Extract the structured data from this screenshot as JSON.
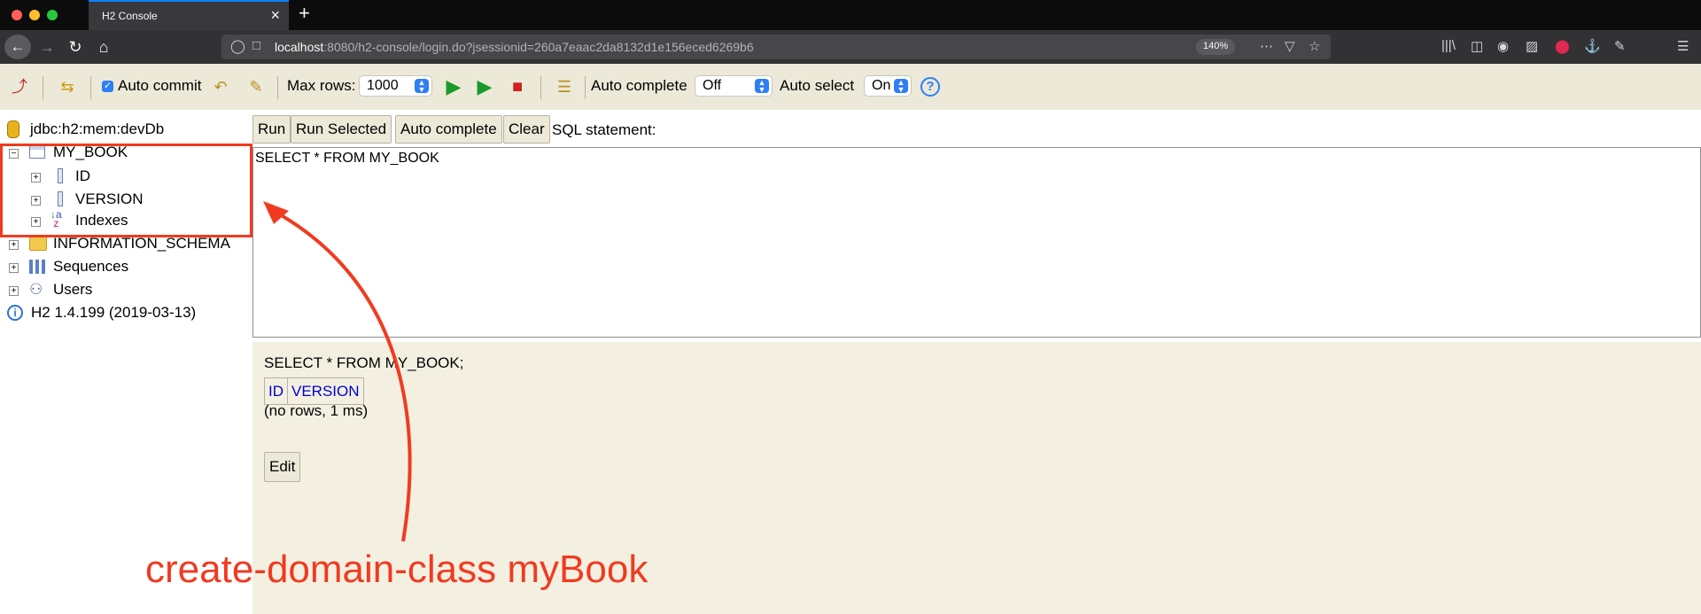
{
  "browser": {
    "tab_title": "H2 Console",
    "url_host": "localhost",
    "url_rest": ":8080/h2-console/login.do?jsessionid=260a7eaac2da8132d1e156eced6269b6",
    "zoom": "140%",
    "icons": [
      "back-icon",
      "forward-icon",
      "reload-icon",
      "home-icon",
      "shield-icon",
      "page-icon",
      "more-icon",
      "pocket-icon",
      "star-icon",
      "library-icon",
      "sidebar-icon",
      "account-icon",
      "reader-icon",
      "extension-icon",
      "menu-icon"
    ]
  },
  "toolbar": {
    "auto_commit_label": "Auto commit",
    "max_rows_label": "Max rows:",
    "max_rows_value": "1000",
    "auto_complete_label": "Auto complete",
    "auto_complete_value": "Off",
    "auto_select_label": "Auto select",
    "auto_select_value": "On",
    "help_glyph": "?"
  },
  "tree": {
    "connection": "jdbc:h2:mem:devDb",
    "table": "MY_BOOK",
    "columns": [
      "ID",
      "VERSION"
    ],
    "indexes": "Indexes",
    "info_schema": "INFORMATION_SCHEMA",
    "sequences": "Sequences",
    "users": "Users",
    "version": "H2 1.4.199 (2019-03-13)"
  },
  "editor": {
    "run": "Run",
    "run_selected": "Run Selected",
    "auto_complete": "Auto complete",
    "clear": "Clear",
    "sql_label": "SQL statement:",
    "sql_text": "SELECT * FROM MY_BOOK"
  },
  "result": {
    "query": "SELECT * FROM MY_BOOK;",
    "headers": [
      "ID",
      "VERSION"
    ],
    "status": "(no rows, 1 ms)",
    "edit": "Edit"
  },
  "annotation": {
    "text": "create-domain-class myBook",
    "color": "#f03b20"
  }
}
